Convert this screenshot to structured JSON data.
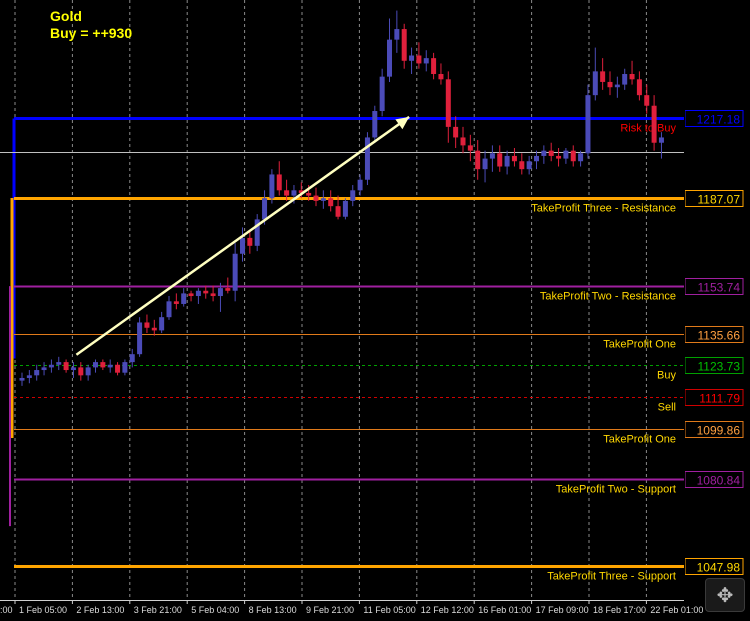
{
  "title": {
    "symbol": "Gold",
    "signal": "Buy = ++930"
  },
  "chart_data": {
    "type": "candlestick",
    "ylim": [
      1035,
      1262
    ],
    "grid": true,
    "x_ticks": [
      "1 Feb 05:00",
      "2 Feb 13:00",
      "3 Feb 21:00",
      "5 Feb 04:00",
      "8 Feb 13:00",
      "9 Feb 21:00",
      "11 Feb 05:00",
      "12 Feb 12:00",
      "16 Feb 01:00",
      "17 Feb 09:00",
      "18 Feb 17:00",
      "22 Feb 01:00"
    ],
    "edge_label_x": ":00",
    "levels": [
      {
        "name": "risk-to-buy",
        "price": 1217.18,
        "price_label": "1217.18",
        "label": "Risk to Buy",
        "color": "#0000ff",
        "label_color": "#ff0000",
        "box_text_color": "#0000ff",
        "style": "solid",
        "width": 3
      },
      {
        "name": "current-price",
        "price": 1204.5,
        "price_label": "",
        "label": "",
        "color": "#c0c0c0",
        "label_color": "#c0c0c0",
        "box_text_color": "#c0c0c0",
        "style": "solid",
        "width": 1
      },
      {
        "name": "take-profit-three-resistance",
        "price": 1187.07,
        "price_label": "1187.07",
        "label": "TakeProfit Three - Resistance",
        "color": "#ffa500",
        "label_color": "#ffd700",
        "box_text_color": "#ffd700",
        "style": "solid",
        "width": 3
      },
      {
        "name": "take-profit-two-resistance",
        "price": 1153.74,
        "price_label": "1153.74",
        "label": "TakeProfit Two - Resistance",
        "color": "#a020a0",
        "label_color": "#ffd700",
        "box_text_color": "#a020a0",
        "style": "solid",
        "width": 2
      },
      {
        "name": "take-profit-one-upper",
        "price": 1135.66,
        "price_label": "1135.66",
        "label": "TakeProfit One",
        "color": "#e07a1a",
        "label_color": "#ffd700",
        "box_text_color": "#ffa040",
        "style": "solid",
        "width": 1
      },
      {
        "name": "buy",
        "price": 1123.73,
        "price_label": "1123.73",
        "label": "Buy",
        "color": "#00a000",
        "label_color": "#ffd700",
        "box_text_color": "#00c000",
        "style": "dashed",
        "width": 1
      },
      {
        "name": "sell",
        "price": 1111.79,
        "price_label": "1111.79",
        "label": "Sell",
        "color": "#d00000",
        "label_color": "#ffd700",
        "box_text_color": "#ff0000",
        "style": "dashed",
        "width": 1
      },
      {
        "name": "take-profit-one-lower",
        "price": 1099.86,
        "price_label": "1099.86",
        "label": "TakeProfit One",
        "color": "#e07a1a",
        "label_color": "#ffd700",
        "box_text_color": "#ffa040",
        "style": "solid",
        "width": 1
      },
      {
        "name": "take-profit-two-support",
        "price": 1080.84,
        "price_label": "1080.84",
        "label": "TakeProfit Two - Support",
        "color": "#a020a0",
        "label_color": "#ffd700",
        "box_text_color": "#a020a0",
        "style": "solid",
        "width": 2
      },
      {
        "name": "take-profit-three-support",
        "price": 1047.98,
        "price_label": "1047.98",
        "label": "TakeProfit Three - Support",
        "color": "#ffa500",
        "label_color": "#ffd700",
        "box_text_color": "#ffd700",
        "style": "solid",
        "width": 3
      }
    ],
    "candles": [
      [
        1118,
        1121,
        1116,
        1119
      ],
      [
        1119,
        1122,
        1117,
        1120
      ],
      [
        1120,
        1124,
        1118,
        1122
      ],
      [
        1122,
        1125,
        1120,
        1123
      ],
      [
        1123,
        1126,
        1121,
        1124
      ],
      [
        1124,
        1127,
        1122,
        1125
      ],
      [
        1125,
        1126,
        1121,
        1122
      ],
      [
        1122,
        1125,
        1119,
        1123
      ],
      [
        1123,
        1125,
        1118,
        1120
      ],
      [
        1120,
        1124,
        1118,
        1123
      ],
      [
        1123,
        1126,
        1121,
        1125
      ],
      [
        1125,
        1126,
        1122,
        1123
      ],
      [
        1123,
        1126,
        1121,
        1124
      ],
      [
        1124,
        1125,
        1120,
        1121
      ],
      [
        1121,
        1126,
        1120,
        1125
      ],
      [
        1125,
        1130,
        1123,
        1128
      ],
      [
        1128,
        1142,
        1127,
        1140
      ],
      [
        1140,
        1143,
        1136,
        1138
      ],
      [
        1138,
        1141,
        1135,
        1137
      ],
      [
        1137,
        1144,
        1136,
        1142
      ],
      [
        1142,
        1150,
        1141,
        1148
      ],
      [
        1148,
        1151,
        1145,
        1147
      ],
      [
        1147,
        1153,
        1146,
        1151
      ],
      [
        1151,
        1152,
        1148,
        1150
      ],
      [
        1150,
        1153,
        1147,
        1152
      ],
      [
        1152,
        1154,
        1149,
        1151
      ],
      [
        1151,
        1154,
        1148,
        1150
      ],
      [
        1150,
        1155,
        1144,
        1153
      ],
      [
        1153,
        1157,
        1151,
        1152
      ],
      [
        1152,
        1170,
        1148,
        1166
      ],
      [
        1166,
        1176,
        1163,
        1172
      ],
      [
        1172,
        1175,
        1166,
        1169
      ],
      [
        1169,
        1181,
        1167,
        1179
      ],
      [
        1179,
        1190,
        1177,
        1187
      ],
      [
        1187,
        1198,
        1185,
        1196
      ],
      [
        1196,
        1201,
        1188,
        1190
      ],
      [
        1190,
        1194,
        1186,
        1188
      ],
      [
        1188,
        1192,
        1185,
        1190
      ],
      [
        1190,
        1193,
        1187,
        1189
      ],
      [
        1189,
        1192,
        1186,
        1188
      ],
      [
        1188,
        1191,
        1184,
        1186
      ],
      [
        1186,
        1190,
        1183,
        1187
      ],
      [
        1187,
        1190,
        1182,
        1184
      ],
      [
        1184,
        1188,
        1179,
        1180
      ],
      [
        1180,
        1187,
        1179,
        1186
      ],
      [
        1186,
        1192,
        1184,
        1190
      ],
      [
        1190,
        1196,
        1188,
        1194
      ],
      [
        1194,
        1212,
        1192,
        1210
      ],
      [
        1210,
        1222,
        1208,
        1220
      ],
      [
        1220,
        1236,
        1218,
        1233
      ],
      [
        1233,
        1255,
        1231,
        1247
      ],
      [
        1247,
        1258,
        1242,
        1251
      ],
      [
        1251,
        1253,
        1236,
        1239
      ],
      [
        1239,
        1244,
        1234,
        1241
      ],
      [
        1241,
        1246,
        1236,
        1238
      ],
      [
        1238,
        1243,
        1235,
        1240
      ],
      [
        1240,
        1242,
        1232,
        1234
      ],
      [
        1234,
        1238,
        1230,
        1232
      ],
      [
        1232,
        1235,
        1208,
        1214
      ],
      [
        1214,
        1218,
        1206,
        1210
      ],
      [
        1210,
        1214,
        1204,
        1207
      ],
      [
        1207,
        1211,
        1201,
        1205
      ],
      [
        1205,
        1209,
        1194,
        1198
      ],
      [
        1198,
        1205,
        1193,
        1202
      ],
      [
        1202,
        1207,
        1197,
        1204
      ],
      [
        1204,
        1207,
        1197,
        1199
      ],
      [
        1199,
        1205,
        1196,
        1203
      ],
      [
        1203,
        1206,
        1199,
        1201
      ],
      [
        1201,
        1204,
        1196,
        1198
      ],
      [
        1198,
        1203,
        1196,
        1201
      ],
      [
        1201,
        1205,
        1198,
        1203
      ],
      [
        1203,
        1207,
        1200,
        1205
      ],
      [
        1205,
        1208,
        1201,
        1203
      ],
      [
        1203,
        1206,
        1199,
        1202
      ],
      [
        1202,
        1206,
        1200,
        1205
      ],
      [
        1205,
        1207,
        1199,
        1201
      ],
      [
        1201,
        1205,
        1199,
        1204
      ],
      [
        1204,
        1230,
        1202,
        1226
      ],
      [
        1226,
        1244,
        1224,
        1235
      ],
      [
        1235,
        1240,
        1228,
        1231
      ],
      [
        1231,
        1235,
        1226,
        1229
      ],
      [
        1229,
        1233,
        1225,
        1230
      ],
      [
        1230,
        1236,
        1228,
        1234
      ],
      [
        1234,
        1239,
        1230,
        1232
      ],
      [
        1232,
        1235,
        1224,
        1226
      ],
      [
        1226,
        1230,
        1219,
        1222
      ],
      [
        1222,
        1226,
        1205,
        1208
      ],
      [
        1208,
        1212,
        1202,
        1210
      ]
    ],
    "arrow": {
      "from_index": 4,
      "from_price": 1124,
      "to_index": 49,
      "to_price": 1217
    }
  }
}
